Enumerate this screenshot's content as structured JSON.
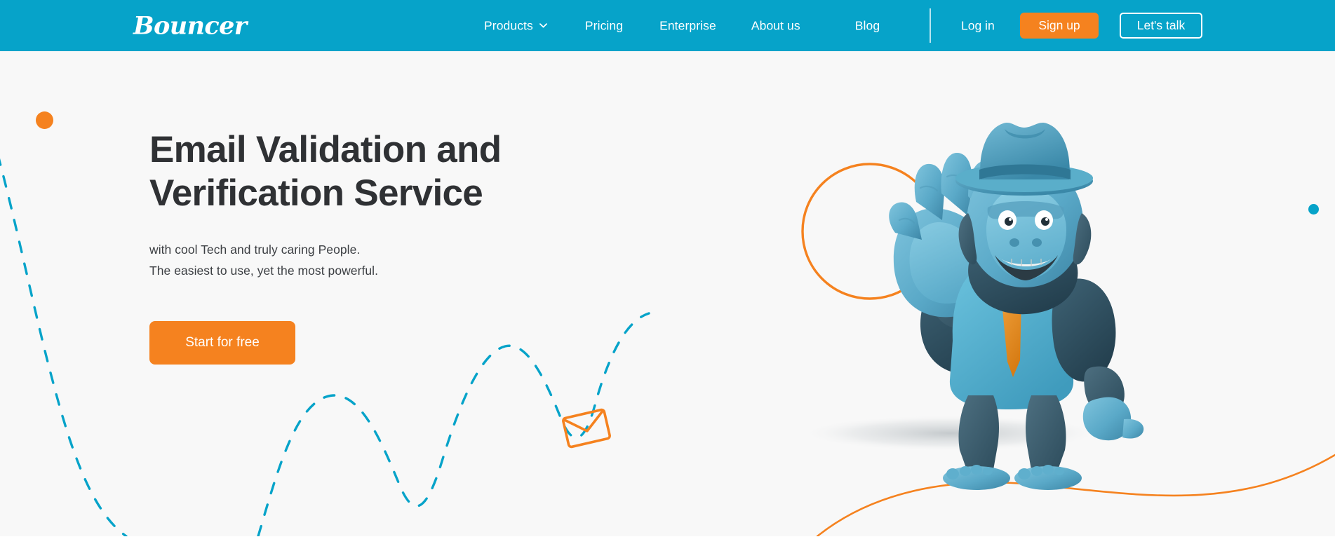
{
  "brand": {
    "logo_text": "Bouncer",
    "teal": "#06a3c9",
    "orange": "#f5821f",
    "cyan_accent": "#06a3c9",
    "hero_bg": "#f8f8f8",
    "heading_color": "#2f3134"
  },
  "nav": {
    "items": [
      {
        "label": "Products",
        "has_dropdown": true,
        "icon": "chevron-down-icon"
      },
      {
        "label": "Pricing",
        "has_dropdown": false
      },
      {
        "label": "Enterprise",
        "has_dropdown": false
      },
      {
        "label": "About us",
        "has_dropdown": false
      },
      {
        "label": "Blog",
        "has_dropdown": false
      }
    ],
    "login_label": "Log in",
    "signup_label": "Sign up",
    "contact_label": "Let's talk"
  },
  "hero": {
    "headline_line_1": "Email Validation and",
    "headline_line_2": "Verification Service",
    "subline_1": "with cool Tech and truly caring People.",
    "subline_2": "The easiest to use, yet the most powerful.",
    "cta_label": "Start for free",
    "decorations": {
      "orange_dot": "orange-dot",
      "cyan_dot": "cyan-dot",
      "dashed_curve_left": "cyan-dashed-curve",
      "dashed_wave": "cyan-dashed-wave",
      "envelope": "envelope-icon",
      "orange_ring": "orange-circle-outline",
      "orange_ground_curve": "orange-ground-curve"
    },
    "mascot": {
      "name": "gorilla-mascot",
      "description": "Blue gorilla in hat, light blue shirt and orange tie, waving"
    }
  }
}
